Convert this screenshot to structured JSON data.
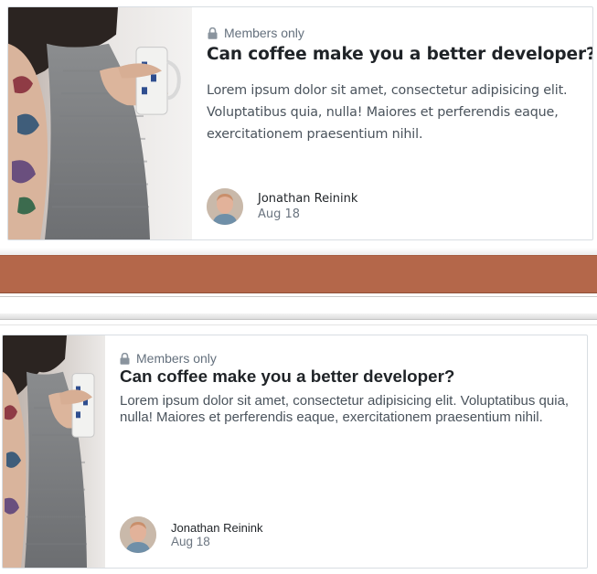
{
  "cards": [
    {
      "badge_label": "Members only",
      "title": "Can coffee make you a better developer?",
      "excerpt": "Lorem ipsum dolor sit amet, consectetur adipisicing elit. Voluptatibus quia, nulla! Maiores et perferendis eaque, exercitationem praesentium nihil.",
      "author_name": "Jonathan Reinink",
      "date": "Aug 18",
      "image_icon": "woman-with-coffee-mug-photo",
      "badge_icon": "lock-icon"
    },
    {
      "badge_label": "Members only",
      "title": "Can coffee make you a better developer?",
      "excerpt": "Lorem ipsum dolor sit amet, consectetur adipisicing elit. Voluptatibus quia, nulla! Maiores et perferendis eaque, exercitationem praesentium nihil.",
      "author_name": "Jonathan Reinink",
      "date": "Aug 18",
      "image_icon": "woman-with-coffee-mug-photo",
      "badge_icon": "lock-icon"
    }
  ],
  "colors": {
    "divider_band": "#b4674a",
    "title_text": "#1f2327",
    "muted_text": "#64707d",
    "card_border": "#d8dde2"
  }
}
